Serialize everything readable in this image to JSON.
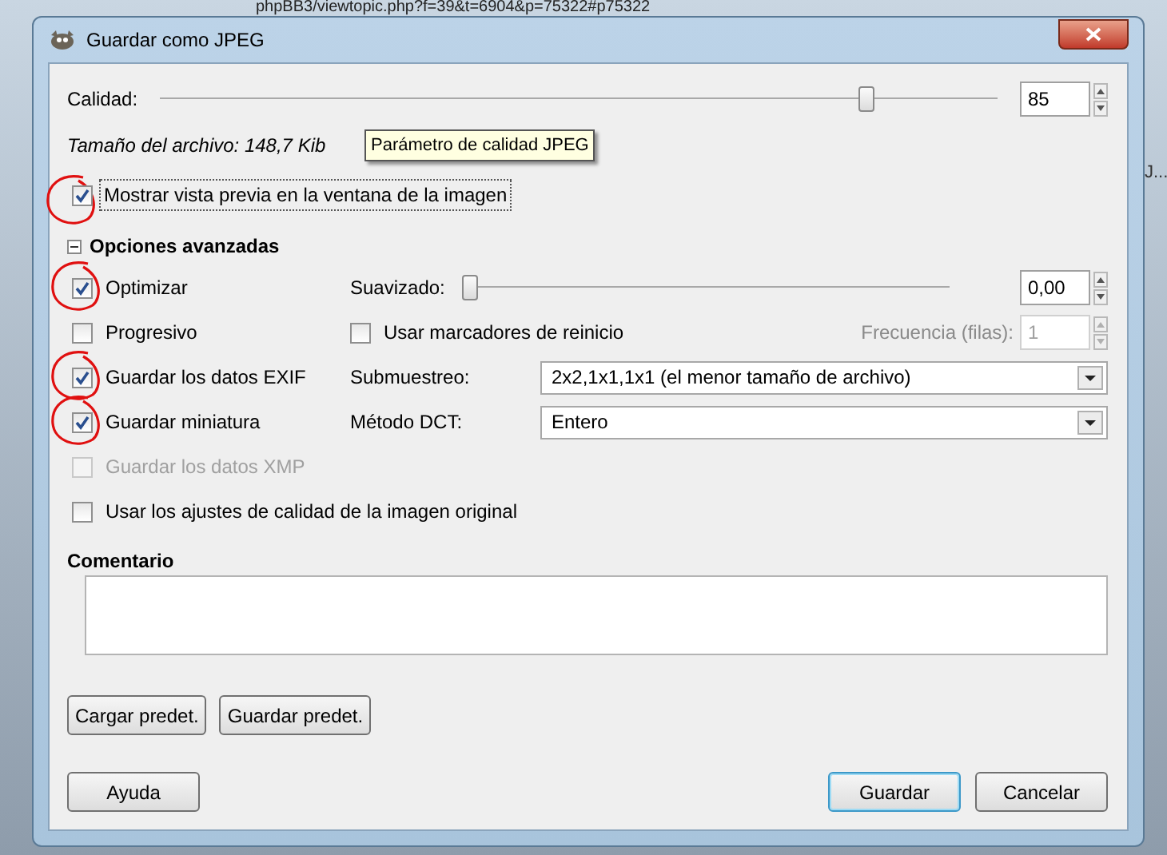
{
  "background": {
    "url_text": "phpBB3/viewtopic.php?f=39&t=6904&p=75322#p75322",
    "side_text": "J..."
  },
  "window": {
    "title": "Guardar como JPEG"
  },
  "quality": {
    "label": "Calidad:",
    "level": 0.85,
    "value": "85"
  },
  "tooltip": "Parámetro de calidad JPEG",
  "file_size": "Tamaño del archivo: 148,7 Kib",
  "preview": {
    "label": "Mostrar vista previa en la ventana de la imagen",
    "checked": true,
    "circled": true
  },
  "advanced": {
    "title": "Opciones avanzadas",
    "expanded": true,
    "options": [
      {
        "label": "Optimizar",
        "checked": true,
        "disabled": false,
        "circled": true
      },
      {
        "label": "Progresivo",
        "checked": false,
        "disabled": false,
        "circled": false
      },
      {
        "label": "Guardar los datos EXIF",
        "checked": true,
        "disabled": false,
        "circled": true
      },
      {
        "label": "Guardar miniatura",
        "checked": true,
        "disabled": false,
        "circled": true
      },
      {
        "label": "Guardar los datos XMP",
        "checked": false,
        "disabled": true,
        "circled": false
      }
    ],
    "original_quality": {
      "label": "Usar los ajustes de calidad de la imagen original",
      "checked": false
    },
    "smoothing": {
      "label": "Suavizado:",
      "level": 0,
      "value": "0,00"
    },
    "restart": {
      "label": "Usar marcadores de reinicio",
      "checked": false
    },
    "frequency": {
      "label": "Frecuencia (filas):",
      "value": "1",
      "disabled": true
    },
    "subsampling": {
      "label": "Submuestreo:",
      "value": "2x2,1x1,1x1 (el menor tamaño de archivo)"
    },
    "dct": {
      "label": "Método DCT:",
      "value": "Entero"
    }
  },
  "comment": {
    "label": "Comentario"
  },
  "preset_buttons": [
    {
      "label": "Cargar predet.",
      "default": false
    },
    {
      "label": "Guardar predet.",
      "default": false
    }
  ],
  "help_button": {
    "label": "Ayuda"
  },
  "action_buttons": [
    {
      "label": "Guardar",
      "default": true
    },
    {
      "label": "Cancelar",
      "default": false
    }
  ]
}
